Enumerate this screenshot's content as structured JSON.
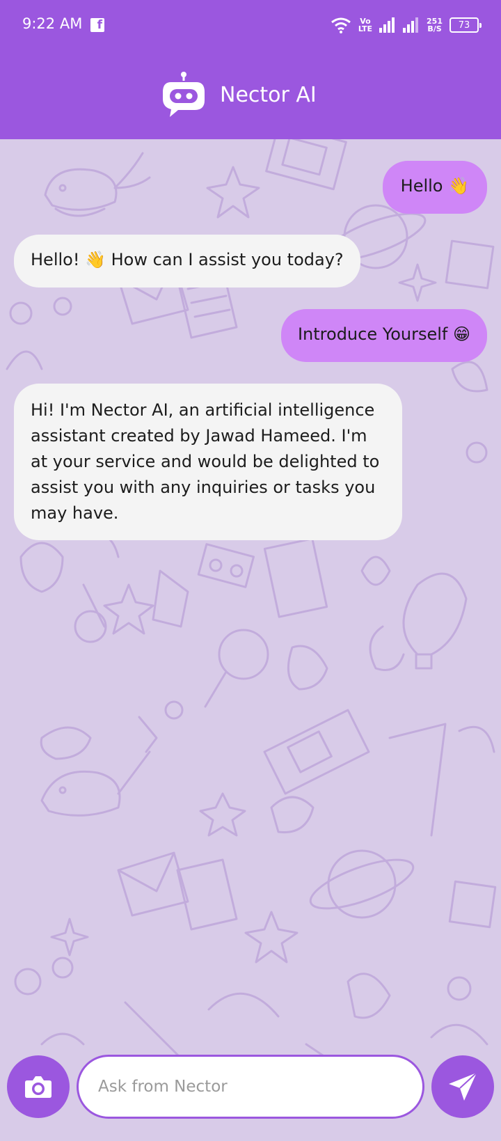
{
  "status_bar": {
    "time": "9:22 AM",
    "volte_top": "Vo",
    "volte_bottom": "LTE",
    "net_speed_value": "251",
    "net_speed_unit": "B/S",
    "battery": "73"
  },
  "header": {
    "title": "Nector AI"
  },
  "messages": [
    {
      "role": "user",
      "text": "Hello 👋"
    },
    {
      "role": "bot",
      "text": "Hello! 👋 How can I assist you today?"
    },
    {
      "role": "user",
      "text": "Introduce Yourself 😁"
    },
    {
      "role": "bot",
      "text": "Hi! I'm Nector AI, an artificial intelligence assistant created by Jawad Hameed. I'm at your service and would be delighted to assist you with any inquiries or tasks you may have."
    }
  ],
  "composer": {
    "placeholder": "Ask from Nector",
    "value": ""
  },
  "icons": {
    "status": [
      "facebook-icon",
      "wifi-icon",
      "signal-icon",
      "battery-icon"
    ],
    "header": "robot-chat-icon",
    "composer": [
      "camera-icon",
      "send-icon"
    ]
  },
  "colors": {
    "primary": "#9b57df",
    "user_bubble": "#cf86f7",
    "bot_bubble": "#f4f4f4",
    "chat_background": "#d8cbe8"
  }
}
